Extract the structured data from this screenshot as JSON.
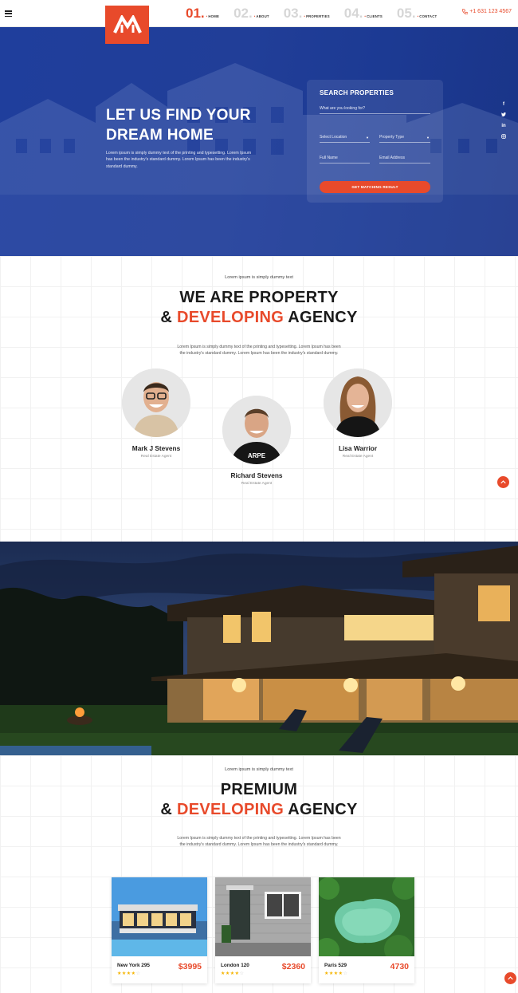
{
  "header": {
    "logo_alt": "M",
    "nav": [
      {
        "num": "01.",
        "label": "HOME",
        "active": true
      },
      {
        "num": "02.",
        "label": "ABOUT",
        "active": false
      },
      {
        "num": "03.",
        "label": "PROPERTIES",
        "active": false
      },
      {
        "num": "04.",
        "label": "CLIENTS",
        "active": false
      },
      {
        "num": "05.",
        "label": "CONTACT",
        "active": false
      }
    ],
    "phone": "+1 631 123 4567"
  },
  "hero": {
    "title_line1": "LET US FIND YOUR",
    "title_line2": "DREAM HOME",
    "text": "Lorem ipsum is simply dummy text of the printing and typesetting. Lorem Ipsum has been the industry's standard dummy. Lorem Ipsum has been the industry's standard dummy."
  },
  "search": {
    "title": "SEARCH PROPERTIES",
    "looking_placeholder": "What are you looking for?",
    "location_placeholder": "Select Location",
    "type_placeholder": "Property Type",
    "name_placeholder": "Full Name",
    "email_placeholder": "Email Address",
    "button": "GET MATCHING RESULT"
  },
  "social": [
    "f",
    "t",
    "in",
    "ig"
  ],
  "about": {
    "kicker": "Lorem ipsum is simply dummy text",
    "title_line1": "WE ARE PROPERTY",
    "title_amp": "& ",
    "title_accent": "DEVELOPING",
    "title_rest": " AGENCY",
    "paragraph": "Lorem Ipsum is simply dummy text of the printing and typesetting. Lorem Ipsum has been the industry's standard dummy. Lorem Ipsum has been the industry's standard dummy.",
    "agents": [
      {
        "name": "Mark J Stevens",
        "role": "Real Estate Agent"
      },
      {
        "name": "Richard Stevens",
        "role": "Real Estate Agent"
      },
      {
        "name": "Lisa Warrior",
        "role": "Real Estate Agent"
      }
    ]
  },
  "premium": {
    "kicker": "Lorem ipsum is simply dummy text",
    "title_line1": "PREMIUM",
    "title_amp": "& ",
    "title_accent": "DEVELOPING",
    "title_rest": " AGENCY",
    "paragraph": "Lorem Ipsum is simply dummy text of the printing and typesetting. Lorem Ipsum has been the industry's standard dummy. Lorem Ipsum has been the industry's standard dummy.",
    "properties": [
      {
        "name": "New York 295",
        "price": "$3995",
        "rating": 4
      },
      {
        "name": "London 120",
        "price": "$2360",
        "rating": 4
      },
      {
        "name": "Paris 529",
        "price": "4730",
        "rating": 4
      }
    ]
  },
  "colors": {
    "accent": "#e84a2b",
    "hero_blue": "#213e98"
  },
  "icons": {
    "menu": "hamburger-icon",
    "phone": "phone-icon",
    "scroll_top": "chevron-up-icon"
  }
}
